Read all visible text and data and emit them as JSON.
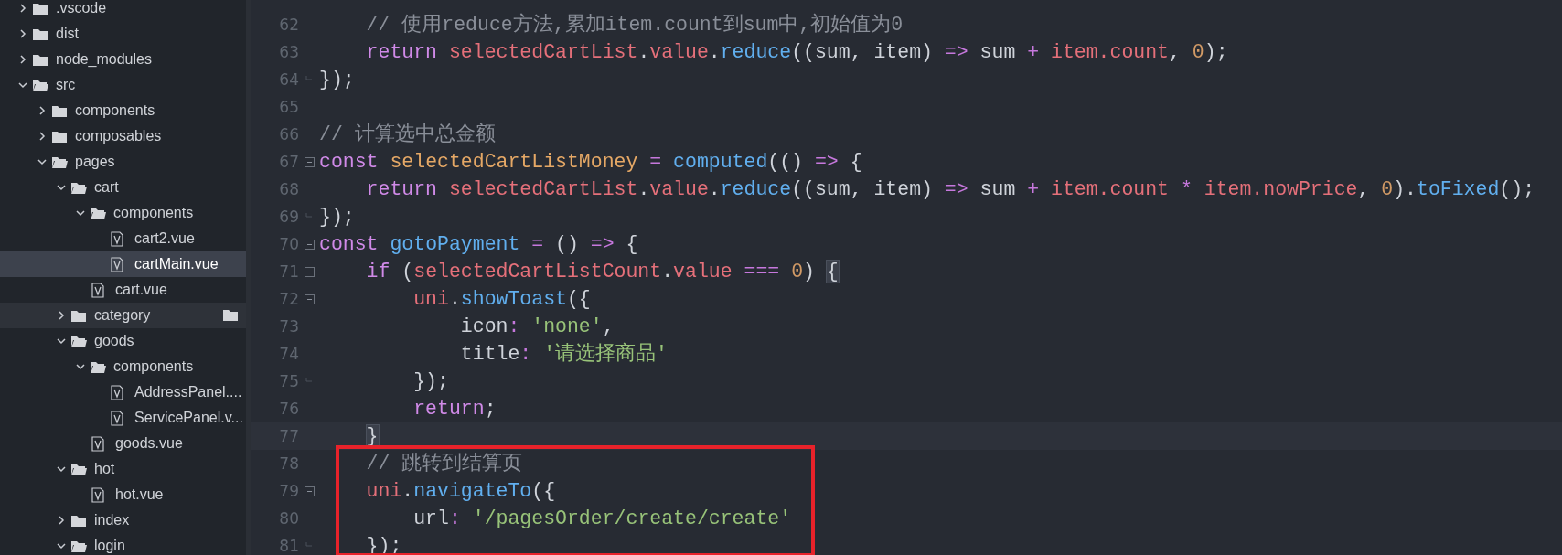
{
  "sidebar": {
    "tree": [
      {
        "name": ".vscode",
        "kind": "folder",
        "expanded": false,
        "selected": false,
        "hovered": false
      },
      {
        "name": "dist",
        "kind": "folder",
        "expanded": false,
        "selected": false,
        "hovered": false
      },
      {
        "name": "node_modules",
        "kind": "folder",
        "expanded": false,
        "selected": false,
        "hovered": false
      },
      {
        "name": "src",
        "kind": "folder",
        "expanded": true,
        "selected": false,
        "hovered": false,
        "children": [
          {
            "name": "components",
            "kind": "folder",
            "expanded": false,
            "selected": false,
            "hovered": false
          },
          {
            "name": "composables",
            "kind": "folder",
            "expanded": false,
            "selected": false,
            "hovered": false
          },
          {
            "name": "pages",
            "kind": "folder",
            "expanded": true,
            "selected": false,
            "hovered": false,
            "children": [
              {
                "name": "cart",
                "kind": "folder",
                "expanded": true,
                "selected": false,
                "hovered": false,
                "children": [
                  {
                    "name": "components",
                    "kind": "folder",
                    "expanded": true,
                    "selected": false,
                    "hovered": false,
                    "children": [
                      {
                        "name": "cart2.vue",
                        "kind": "file",
                        "selected": false,
                        "hovered": false
                      },
                      {
                        "name": "cartMain.vue",
                        "kind": "file",
                        "selected": true,
                        "hovered": false
                      }
                    ]
                  },
                  {
                    "name": "cart.vue",
                    "kind": "file",
                    "selected": false,
                    "hovered": false
                  }
                ]
              },
              {
                "name": "category",
                "kind": "folder",
                "expanded": false,
                "selected": false,
                "hovered": true
              },
              {
                "name": "goods",
                "kind": "folder",
                "expanded": true,
                "selected": false,
                "hovered": false,
                "children": [
                  {
                    "name": "components",
                    "kind": "folder",
                    "expanded": true,
                    "selected": false,
                    "hovered": false,
                    "children": [
                      {
                        "name": "AddressPanel....",
                        "kind": "file",
                        "selected": false,
                        "hovered": false
                      },
                      {
                        "name": "ServicePanel.v...",
                        "kind": "file",
                        "selected": false,
                        "hovered": false
                      }
                    ]
                  },
                  {
                    "name": "goods.vue",
                    "kind": "file",
                    "selected": false,
                    "hovered": false
                  }
                ]
              },
              {
                "name": "hot",
                "kind": "folder",
                "expanded": true,
                "selected": false,
                "hovered": false,
                "children": [
                  {
                    "name": "hot.vue",
                    "kind": "file",
                    "selected": false,
                    "hovered": false
                  }
                ]
              },
              {
                "name": "index",
                "kind": "folder",
                "expanded": false,
                "selected": false,
                "hovered": false
              },
              {
                "name": "login",
                "kind": "folder",
                "expanded": true,
                "selected": false,
                "hovered": false
              }
            ]
          }
        ]
      }
    ]
  },
  "editor": {
    "lines": [
      {
        "number": "62",
        "fold_start": false,
        "fold_end": false,
        "tokens": [
          {
            "text": "    // 使用reduce方法,累加item.count到sum中,初始值为0",
            "kind": "comment"
          }
        ]
      },
      {
        "number": "63",
        "fold_start": false,
        "fold_end": false,
        "tokens": [
          {
            "text": "    return ",
            "kind": "kw"
          },
          {
            "text": "selectedCartList",
            "kind": "var"
          },
          {
            "text": ".",
            "kind": "plain"
          },
          {
            "text": "value",
            "kind": "prop"
          },
          {
            "text": ".",
            "kind": "plain"
          },
          {
            "text": "reduce",
            "kind": "fn"
          },
          {
            "text": "((sum, item) ",
            "kind": "plain"
          },
          {
            "text": "=>",
            "kind": "op"
          },
          {
            "text": " sum ",
            "kind": "plain"
          },
          {
            "text": "+ ",
            "kind": "op"
          },
          {
            "text": "item.count",
            "kind": "var"
          },
          {
            "text": ", ",
            "kind": "plain"
          },
          {
            "text": "0",
            "kind": "num"
          },
          {
            "text": ");",
            "kind": "plain"
          }
        ]
      },
      {
        "number": "64",
        "fold_start": false,
        "fold_end": true,
        "tokens": [
          {
            "text": "});",
            "kind": "plain"
          }
        ]
      },
      {
        "number": "65",
        "fold_start": false,
        "fold_end": false
      },
      {
        "number": "66",
        "fold_start": false,
        "fold_end": false,
        "tokens": [
          {
            "text": "// 计算选中总金额",
            "kind": "comment"
          }
        ]
      },
      {
        "number": "67",
        "fold_start": true,
        "fold_end": false,
        "tokens": [
          {
            "text": "const ",
            "kind": "kw"
          },
          {
            "text": "selectedCartListMoney ",
            "kind": "def"
          },
          {
            "text": "= ",
            "kind": "op"
          },
          {
            "text": "computed",
            "kind": "fn"
          },
          {
            "text": "(() ",
            "kind": "plain"
          },
          {
            "text": "=>",
            "kind": "op"
          },
          {
            "text": " {",
            "kind": "plain"
          }
        ]
      },
      {
        "number": "68",
        "fold_start": false,
        "fold_end": false,
        "tokens": [
          {
            "text": "    return ",
            "kind": "kw"
          },
          {
            "text": "selectedCartList",
            "kind": "var"
          },
          {
            "text": ".",
            "kind": "plain"
          },
          {
            "text": "value",
            "kind": "prop"
          },
          {
            "text": ".",
            "kind": "plain"
          },
          {
            "text": "reduce",
            "kind": "fn"
          },
          {
            "text": "((sum, item) ",
            "kind": "plain"
          },
          {
            "text": "=>",
            "kind": "op"
          },
          {
            "text": " sum ",
            "kind": "plain"
          },
          {
            "text": "+ ",
            "kind": "op"
          },
          {
            "text": "item.count ",
            "kind": "var"
          },
          {
            "text": "* ",
            "kind": "op"
          },
          {
            "text": "item.nowPrice",
            "kind": "var"
          },
          {
            "text": ", ",
            "kind": "plain"
          },
          {
            "text": "0",
            "kind": "num"
          },
          {
            "text": ").",
            "kind": "plain"
          },
          {
            "text": "toFixed",
            "kind": "fn"
          },
          {
            "text": "();",
            "kind": "plain"
          }
        ]
      },
      {
        "number": "69",
        "fold_start": false,
        "fold_end": true,
        "tokens": [
          {
            "text": "});",
            "kind": "plain"
          }
        ]
      },
      {
        "number": "70",
        "fold_start": true,
        "fold_end": false,
        "tokens": [
          {
            "text": "const ",
            "kind": "kw"
          },
          {
            "text": "gotoPayment ",
            "kind": "fn"
          },
          {
            "text": "=",
            "kind": "op"
          },
          {
            "text": " () ",
            "kind": "plain"
          },
          {
            "text": "=>",
            "kind": "op"
          },
          {
            "text": " {",
            "kind": "plain"
          }
        ]
      },
      {
        "number": "71",
        "fold_start": true,
        "fold_end": false,
        "tokens": [
          {
            "text": "    if",
            "kind": "kw"
          },
          {
            "text": " (",
            "kind": "plain"
          },
          {
            "text": "selectedCartListCount",
            "kind": "var"
          },
          {
            "text": ".",
            "kind": "plain"
          },
          {
            "text": "value ",
            "kind": "prop"
          },
          {
            "text": "=== ",
            "kind": "op"
          },
          {
            "text": "0",
            "kind": "num"
          },
          {
            "text": ") ",
            "kind": "plain"
          },
          {
            "text": "{",
            "kind": "match"
          }
        ]
      },
      {
        "number": "72",
        "fold_start": true,
        "fold_end": false,
        "tokens": [
          {
            "text": "        uni",
            "kind": "var"
          },
          {
            "text": ".",
            "kind": "plain"
          },
          {
            "text": "showToast",
            "kind": "fn"
          },
          {
            "text": "({",
            "kind": "plain"
          }
        ]
      },
      {
        "number": "73",
        "fold_start": false,
        "fold_end": false,
        "tokens": [
          {
            "text": "            icon",
            "kind": "plain"
          },
          {
            "text": ": ",
            "kind": "op"
          },
          {
            "text": "'none'",
            "kind": "str"
          },
          {
            "text": ",",
            "kind": "plain"
          }
        ]
      },
      {
        "number": "74",
        "fold_start": false,
        "fold_end": false,
        "tokens": [
          {
            "text": "            title",
            "kind": "plain"
          },
          {
            "text": ": ",
            "kind": "op"
          },
          {
            "text": "'请选择商品'",
            "kind": "str"
          }
        ]
      },
      {
        "number": "75",
        "fold_start": false,
        "fold_end": true,
        "tokens": [
          {
            "text": "        });",
            "kind": "plain"
          }
        ]
      },
      {
        "number": "76",
        "fold_start": false,
        "fold_end": false,
        "tokens": [
          {
            "text": "        return",
            "kind": "kw"
          },
          {
            "text": ";",
            "kind": "plain"
          }
        ]
      },
      {
        "number": "77",
        "fold_start": false,
        "fold_end": false,
        "current": true,
        "tokens": [
          {
            "text": "    }",
            "kind": "match"
          }
        ]
      },
      {
        "number": "78",
        "fold_start": false,
        "fold_end": false,
        "boxed": true,
        "tokens": [
          {
            "text": "    // 跳转到结算页",
            "kind": "comment"
          }
        ]
      },
      {
        "number": "79",
        "fold_start": true,
        "fold_end": false,
        "boxed": true,
        "tokens": [
          {
            "text": "    uni",
            "kind": "var"
          },
          {
            "text": ".",
            "kind": "plain"
          },
          {
            "text": "navigateTo",
            "kind": "fn"
          },
          {
            "text": "({",
            "kind": "plain"
          }
        ]
      },
      {
        "number": "80",
        "fold_start": false,
        "fold_end": false,
        "boxed": true,
        "tokens": [
          {
            "text": "        url",
            "kind": "plain"
          },
          {
            "text": ": ",
            "kind": "op"
          },
          {
            "text": "'/pagesOrder/create/create'",
            "kind": "str"
          }
        ]
      },
      {
        "number": "81",
        "fold_start": false,
        "fold_end": true,
        "boxed": true,
        "tokens": [
          {
            "text": "    });",
            "kind": "plain"
          }
        ]
      }
    ]
  }
}
